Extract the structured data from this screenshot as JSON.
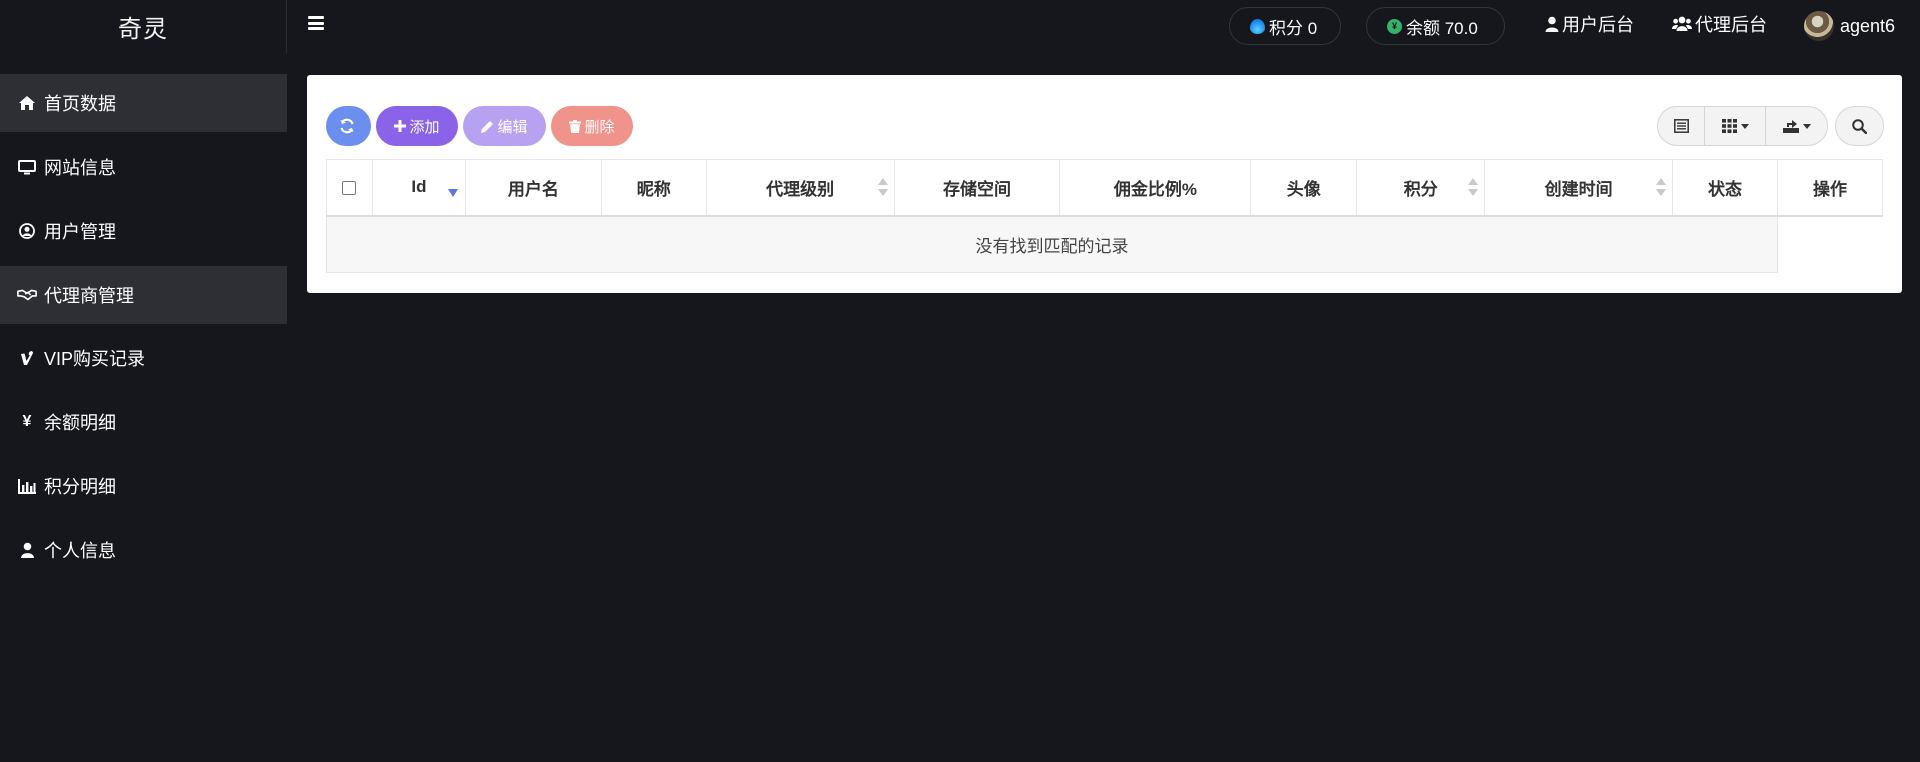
{
  "brand": "奇灵",
  "header": {
    "points": {
      "label": "积分 0"
    },
    "balance": {
      "label": "余额 70.0"
    },
    "user_admin": "用户后台",
    "agent_admin": "代理后台",
    "username": "agent6"
  },
  "sidebar": {
    "items": [
      {
        "label": "首页数据",
        "icon": "home-icon",
        "active": true
      },
      {
        "label": "网站信息",
        "icon": "monitor-icon",
        "active": false
      },
      {
        "label": "用户管理",
        "icon": "user-circle-icon",
        "active": false
      },
      {
        "label": "代理商管理",
        "icon": "handshake-icon",
        "active": true
      },
      {
        "label": "VIP购买记录",
        "icon": "vimeo-icon",
        "active": false
      },
      {
        "label": "余额明细",
        "icon": "yen-icon",
        "active": false
      },
      {
        "label": "积分明细",
        "icon": "bar-chart-icon",
        "active": false
      },
      {
        "label": "个人信息",
        "icon": "user-icon",
        "active": false
      }
    ]
  },
  "toolbar": {
    "add": "添加",
    "edit": "编辑",
    "delete": "删除"
  },
  "table": {
    "columns": [
      "Id",
      "用户名",
      "昵称",
      "代理级别",
      "存储空间",
      "佣金比例%",
      "头像",
      "积分",
      "创建时间",
      "状态",
      "操作"
    ],
    "empty_text": "没有找到匹配的记录"
  },
  "colors": {
    "background": "#16171c",
    "sidebar_active": "#2e2f35",
    "refresh": "#6c8eef",
    "add": "#8a63e8",
    "edit": "#b7a1f1",
    "delete": "#f0938a"
  }
}
